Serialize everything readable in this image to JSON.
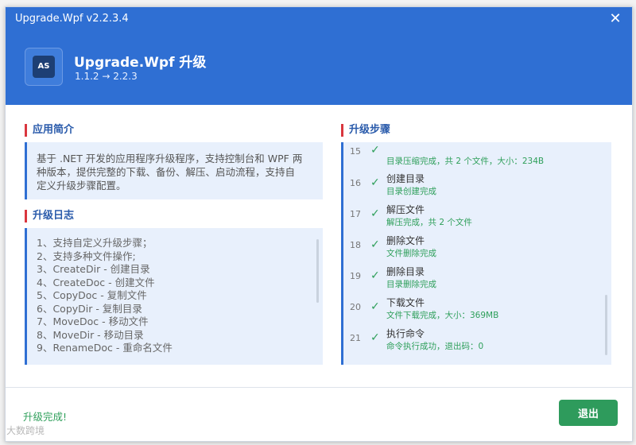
{
  "window": {
    "title": "Upgrade.Wpf v2.2.3.4",
    "close_glyph": "✕"
  },
  "header": {
    "logo_text": "AS",
    "app_title": "Upgrade.Wpf 升级",
    "version_text": "1.1.2 → 2.2.3"
  },
  "intro": {
    "title": "应用简介",
    "lines": [
      "基于 .NET 开发的应用程序升级程序，支持控制台和 WPF 两",
      "种版本，提供完整的下载、备份、解压、启动流程，支持自",
      "定义升级步骤配置。"
    ]
  },
  "changelog": {
    "title": "升级日志",
    "items": [
      "1、支持自定义升级步骤；",
      "2、支持多种文件操作;",
      "3、CreateDir - 创建目录",
      "4、CreateDoc - 创建文件",
      "5、CopyDoc - 复制文件",
      "6、CopyDir - 复制目录",
      "7、MoveDoc - 移动文件",
      "8、MoveDir - 移动目录",
      "9、RenameDoc - 重命名文件"
    ]
  },
  "steps": {
    "title": "升级步骤",
    "items": [
      {
        "num": "15",
        "name": "",
        "detail": "目录压缩完成，共 2 个文件，大小：234B"
      },
      {
        "num": "16",
        "name": "创建目录",
        "detail": "目录创建完成"
      },
      {
        "num": "17",
        "name": "解压文件",
        "detail": "解压完成，共 2 个文件"
      },
      {
        "num": "18",
        "name": "删除文件",
        "detail": "文件删除完成"
      },
      {
        "num": "19",
        "name": "删除目录",
        "detail": "目录删除完成"
      },
      {
        "num": "20",
        "name": "下载文件",
        "detail": "文件下载完成，大小：369MB"
      },
      {
        "num": "21",
        "name": "执行命令",
        "detail": "命令执行成功，退出码：0"
      }
    ]
  },
  "footer": {
    "status": "升级完成!",
    "exit_label": "退出"
  },
  "watermark": "大数跨境",
  "colors": {
    "header": "#2f6fd3",
    "success": "#2e9f5a",
    "section_title": "#2a5bab",
    "accent_bar": "#d9363e"
  }
}
